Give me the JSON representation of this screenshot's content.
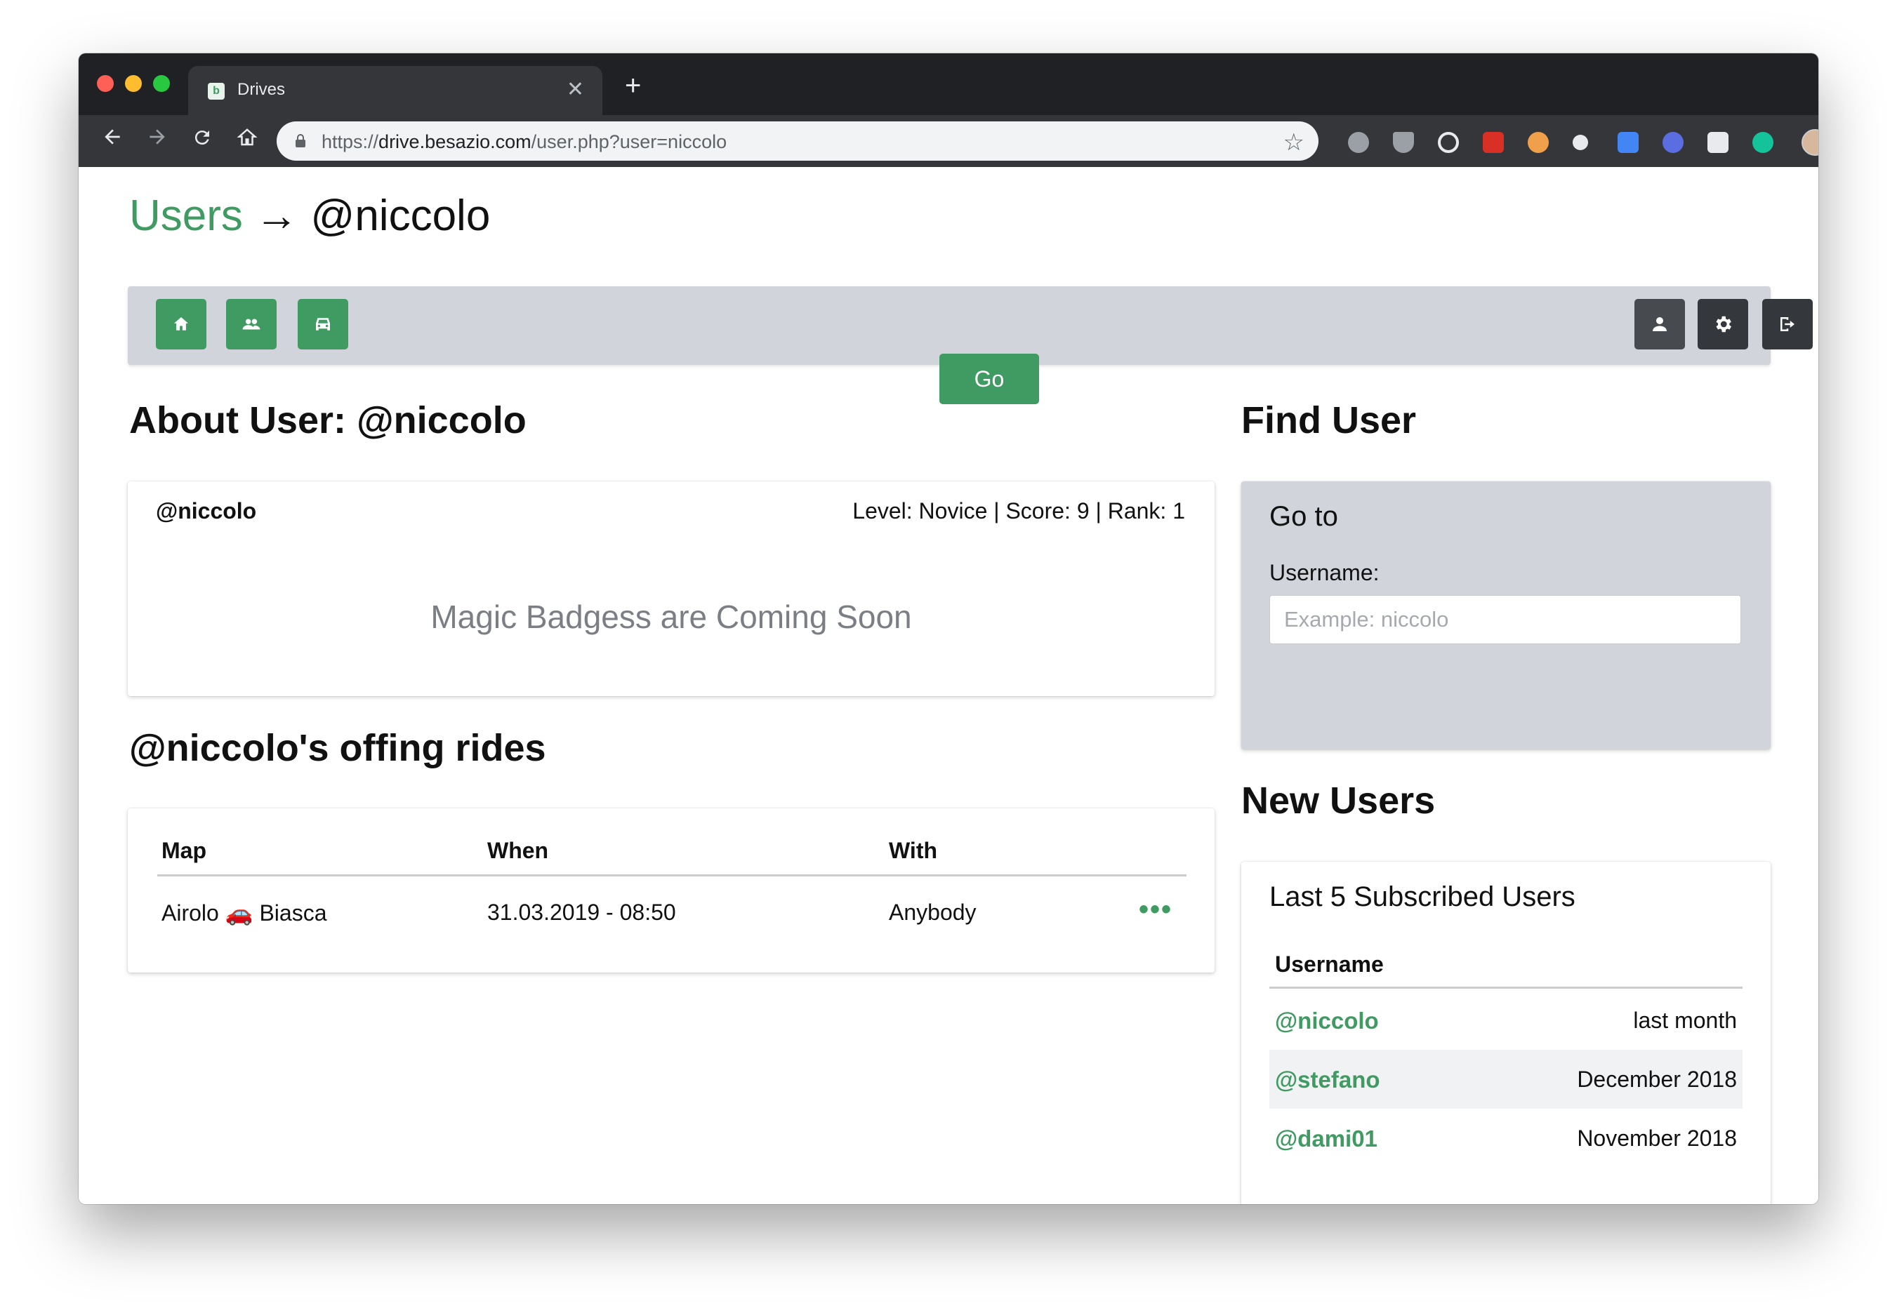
{
  "browser": {
    "tab_title": "Drives",
    "tab_close": "✕",
    "new_tab": "+",
    "url_scheme": "https://",
    "url_host": "drive.besazio.com",
    "url_path": "/user.php?user=niccolo",
    "extensions": [
      "adblock-plus",
      "shield",
      "block",
      "bookmark-plus",
      "eyes",
      "dots",
      "translate",
      "puzzle",
      "smiley",
      "grammarly"
    ]
  },
  "breadcrumb": {
    "root": "Users",
    "arrow": "→",
    "current": "@niccolo"
  },
  "nav": {
    "left_buttons": [
      "home-icon",
      "users-icon",
      "car-icon"
    ],
    "right_buttons": [
      "profile-icon",
      "gear-icon",
      "logout-icon"
    ]
  },
  "about": {
    "heading": "About User: @niccolo",
    "username": "@niccolo",
    "stats": "Level: Novice | Score: 9 | Rank: 1",
    "message": "Magic Badgess are Coming Soon"
  },
  "rides": {
    "heading": "@niccolo's offing rides",
    "columns": [
      "Map",
      "When",
      "With"
    ],
    "rows": [
      {
        "map": "Airolo 🚗 Biasca",
        "when": "31.03.2019 - 08:50",
        "with": "Anybody",
        "more": "•••"
      }
    ]
  },
  "find": {
    "heading": "Find User",
    "title": "Go to",
    "label": "Username:",
    "placeholder": "Example: niccolo",
    "value": "",
    "button": "Go"
  },
  "new_users": {
    "heading": "New Users",
    "title": "Last 5 Subscribed Users",
    "column": "Username",
    "rows": [
      {
        "user": "@niccolo",
        "when": "last month"
      },
      {
        "user": "@stefano",
        "when": "December 2018"
      },
      {
        "user": "@dami01",
        "when": "November 2018"
      }
    ]
  },
  "colors": {
    "accent": "#3f9b62",
    "navbar": "#d1d5db",
    "chrome": "#202124"
  }
}
